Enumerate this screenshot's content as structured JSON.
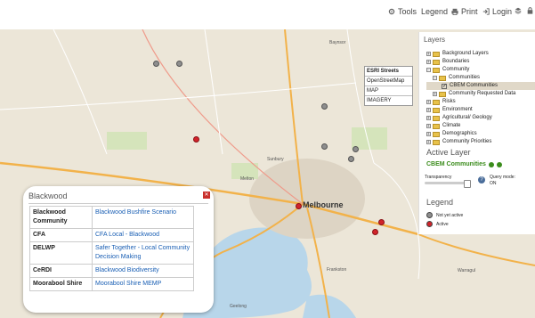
{
  "toolbar": {
    "tools_label": "Tools",
    "legend_label": "Legend",
    "print_label": "Print",
    "login_label": "Login"
  },
  "basemaps": [
    "ESRI Streets",
    "OpenStreetMap",
    "MAP",
    "IMAGERY"
  ],
  "map_labels": {
    "sunbury": "Sunbury",
    "melton": "Melton",
    "melbourne": "Melbourne",
    "frankston": "Frankston",
    "warragul": "Warragul",
    "geelong": "Geelong",
    "baynsor": "Baynsor"
  },
  "layers_panel": {
    "title": "Layers",
    "tree": [
      {
        "label": "Background Layers",
        "toggle": "+"
      },
      {
        "label": "Boundaries",
        "toggle": "+"
      },
      {
        "label": "Community",
        "toggle": "−"
      },
      {
        "label": "Communities",
        "toggle": "−"
      },
      {
        "label": "CBEM Communities",
        "checked": "✓"
      },
      {
        "label": "Community Requested Data",
        "toggle": "+"
      },
      {
        "label": "Risks",
        "toggle": "+"
      },
      {
        "label": "Environment",
        "toggle": "+"
      },
      {
        "label": "Agricultural/ Geology",
        "toggle": "+"
      },
      {
        "label": "Climate",
        "toggle": "+"
      },
      {
        "label": "Demographics",
        "toggle": "+"
      },
      {
        "label": "Community Priorities",
        "toggle": "+"
      }
    ],
    "active_layer_title": "Active Layer",
    "active_layer_name": "CBEM Communities",
    "transparency_label": "Transparency",
    "query_mode_label": "Query mode:",
    "query_mode_value": "ON",
    "legend_title": "Legend",
    "legend_items": [
      {
        "label": "Not yet active",
        "color": "#8e8e8e"
      },
      {
        "label": "Active",
        "color": "#d1232a"
      }
    ]
  },
  "popup": {
    "title": "Blackwood",
    "rows": [
      {
        "org": "Blackwood Community",
        "link": "Blackwood Bushfire Scenario"
      },
      {
        "org": "CFA",
        "link": "CFA Local - Blackwood"
      },
      {
        "org": "DELWP",
        "link": "Safer Together - Local Community Decision Making"
      },
      {
        "org": "CeRDI",
        "link": "Blackwood Biodiversity"
      },
      {
        "org": "Moorabool Shire",
        "link": "Moorabool Shire MEMP"
      }
    ]
  },
  "colors": {
    "accent_green": "#3b8c1c",
    "link_blue": "#1a5fb4",
    "active_red": "#d1232a",
    "inactive_grey": "#8e8e8e"
  }
}
